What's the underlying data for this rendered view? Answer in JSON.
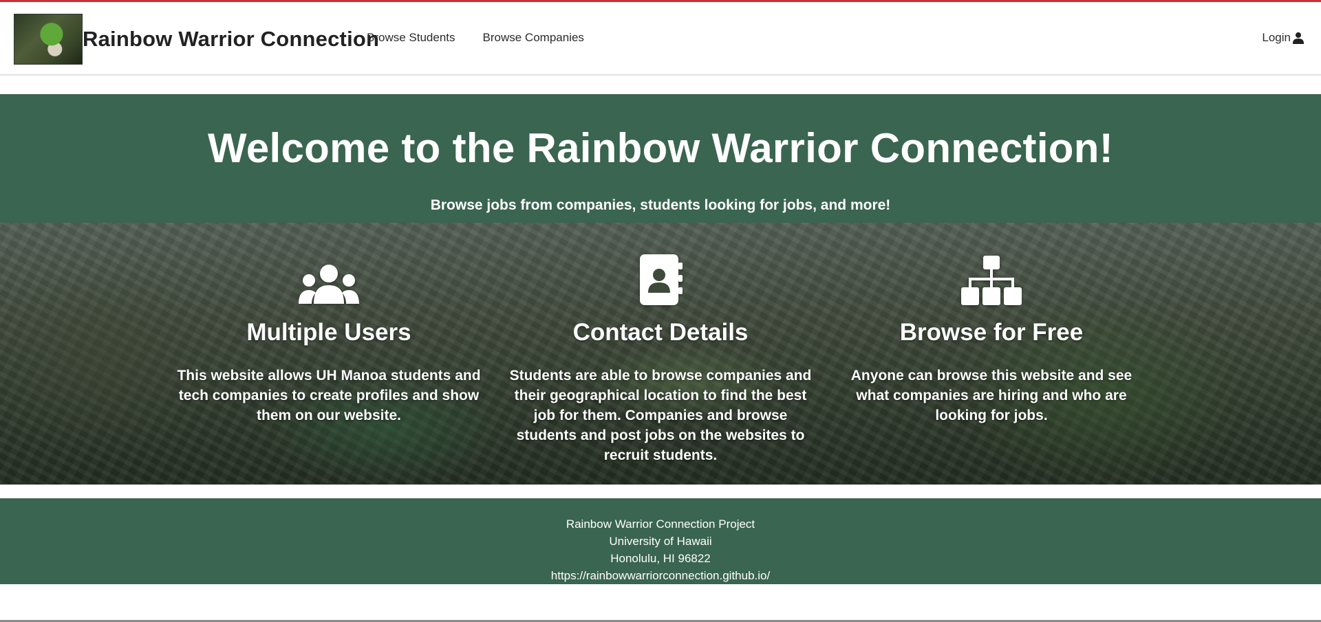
{
  "navbar": {
    "brand_title": "Rainbow Warrior Connection",
    "logo_icon": "kermit-banjo-logo",
    "links": [
      {
        "label": "Browse Students"
      },
      {
        "label": "Browse Companies"
      }
    ],
    "login_label": "Login",
    "login_icon": "user-icon"
  },
  "hero": {
    "title": "Welcome to the Rainbow Warrior Connection!",
    "subtitle": "Browse jobs from companies, students looking for jobs, and more!"
  },
  "features": [
    {
      "icon": "users-icon",
      "title": "Multiple Users",
      "text": "This website allows UH Manoa students and tech companies to create profiles and show them on our website."
    },
    {
      "icon": "address-book-icon",
      "title": "Contact Details",
      "text": "Students are able to browse companies and their geographical location to find the best job for them. Companies and browse students and post jobs on the websites to recruit students."
    },
    {
      "icon": "sitemap-icon",
      "title": "Browse for Free",
      "text": "Anyone can browse this website and see what companies are hiring and who are looking for jobs."
    }
  ],
  "footer": {
    "line1": "Rainbow Warrior Connection Project",
    "line2": "University of Hawaii",
    "line3": "Honolulu, HI 96822",
    "line4": "https://rainbowwarriorconnection.github.io/"
  },
  "colors": {
    "accent_green": "#3a6550",
    "top_border": "#c9313a"
  }
}
